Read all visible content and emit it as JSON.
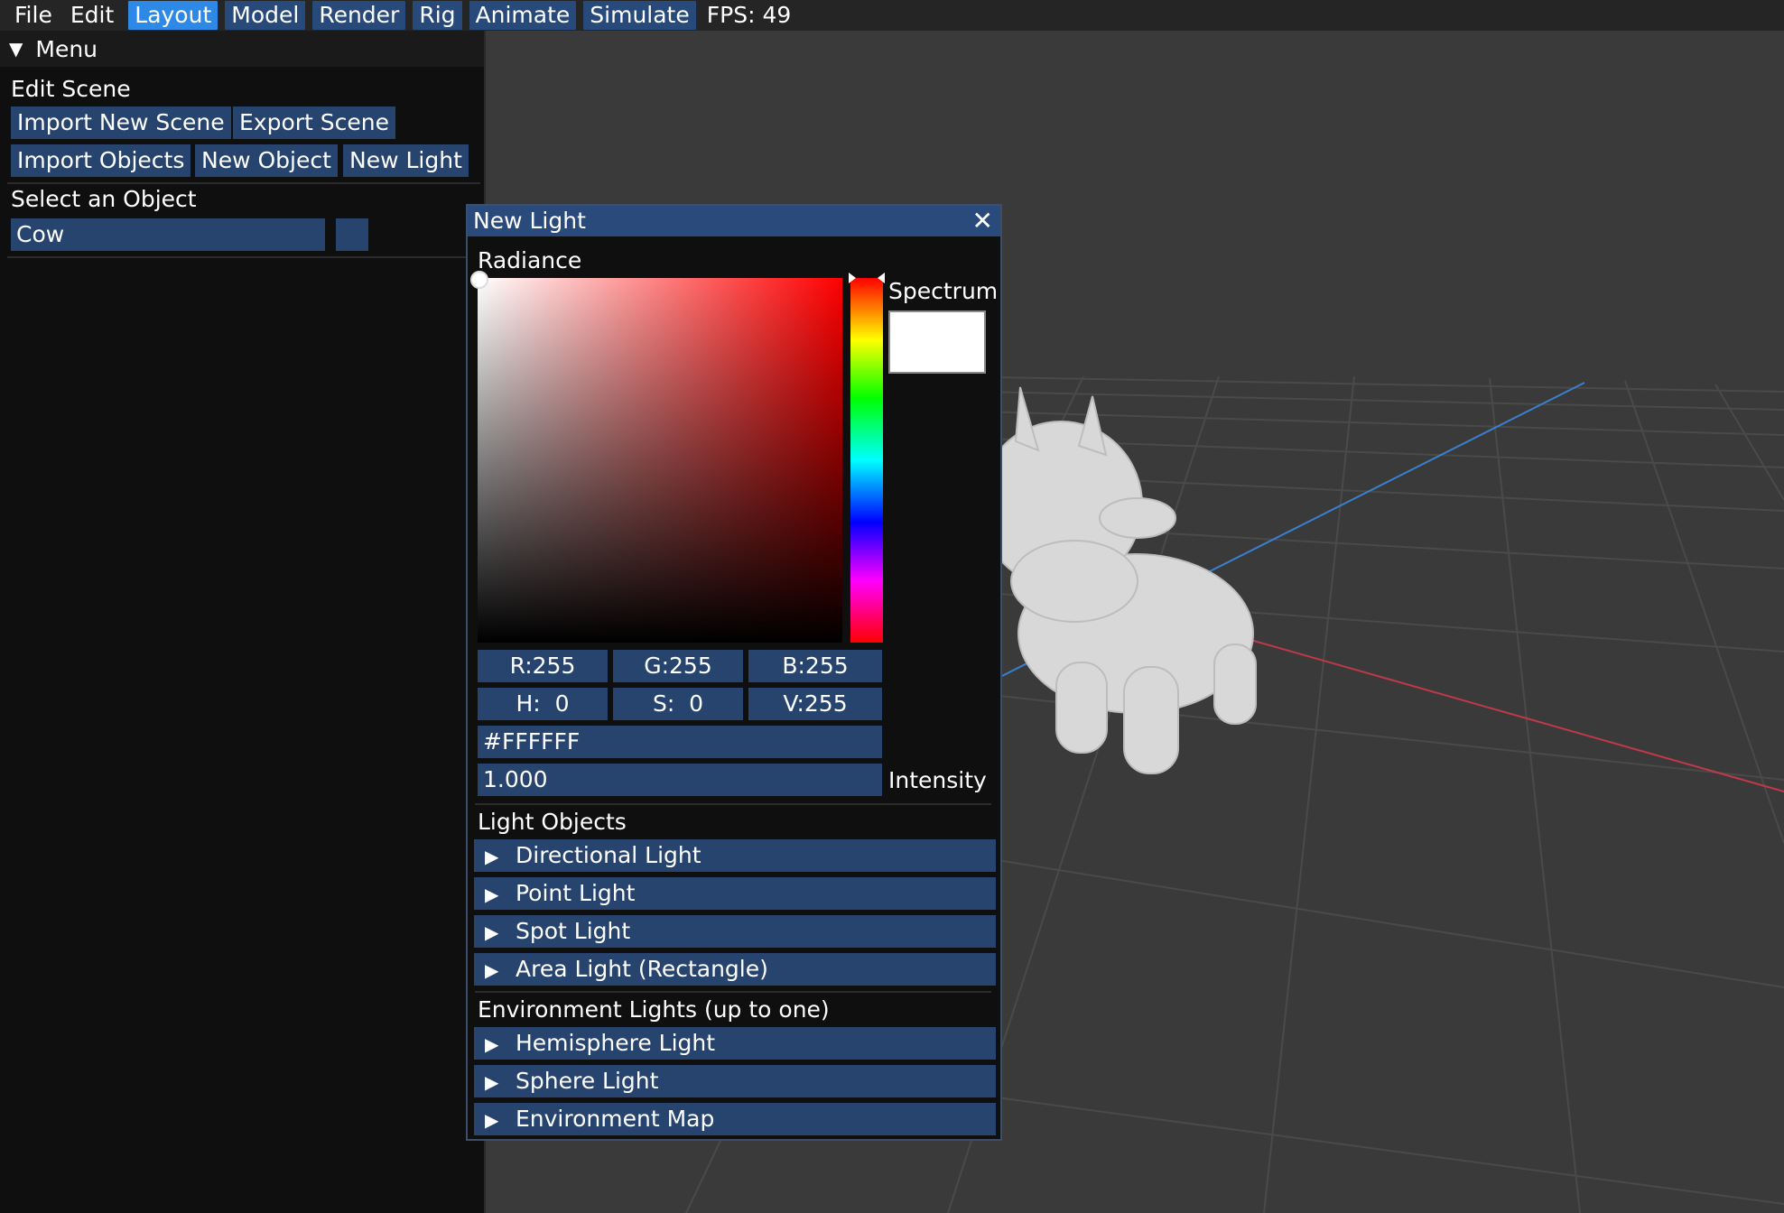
{
  "menubar": {
    "menus": [
      "File",
      "Edit"
    ],
    "modes": [
      {
        "label": "Layout",
        "active": true
      },
      {
        "label": "Model",
        "active": false
      },
      {
        "label": "Render",
        "active": false
      },
      {
        "label": "Rig",
        "active": false
      },
      {
        "label": "Animate",
        "active": false
      },
      {
        "label": "Simulate",
        "active": false
      }
    ],
    "fps": "FPS: 49"
  },
  "panel": {
    "header": "Menu",
    "header_icon": "triangle-down-icon",
    "edit_scene_label": "Edit Scene",
    "buttons": {
      "import_new_scene": "Import New Scene",
      "export_scene": "Export Scene",
      "import_objects": "Import Objects",
      "new_object": "New Object",
      "new_light": "New Light"
    },
    "select_object_label": "Select an Object",
    "selected_object": "Cow"
  },
  "light_window": {
    "title": "New Light",
    "close_icon": "close-icon",
    "radiance_label": "Radiance",
    "spectrum_label": "Spectrum",
    "color": {
      "r": "R:255",
      "g": "G:255",
      "b": "B:255",
      "h": "H:  0",
      "s": "S:  0",
      "v": "V:255",
      "hex": "#FFFFFF",
      "swatch": "#ffffff",
      "hue_gradient_start": "#ff0000"
    },
    "intensity_value": "1.000",
    "intensity_label": "Intensity",
    "light_objects_label": "Light Objects",
    "light_objects": [
      "Directional Light",
      "Point Light",
      "Spot Light",
      "Area Light (Rectangle)"
    ],
    "environment_label": "Environment Lights (up to one)",
    "environment_lights": [
      "Hemisphere Light",
      "Sphere Light",
      "Environment Map"
    ]
  },
  "colors": {
    "accent_active": "#2e89e6",
    "button": "#27446e",
    "panel_bg": "#0f0f0f",
    "viewport_bg": "#3a3a3a",
    "axis_x": "#c0394b",
    "axis_z": "#3a7fd0"
  }
}
